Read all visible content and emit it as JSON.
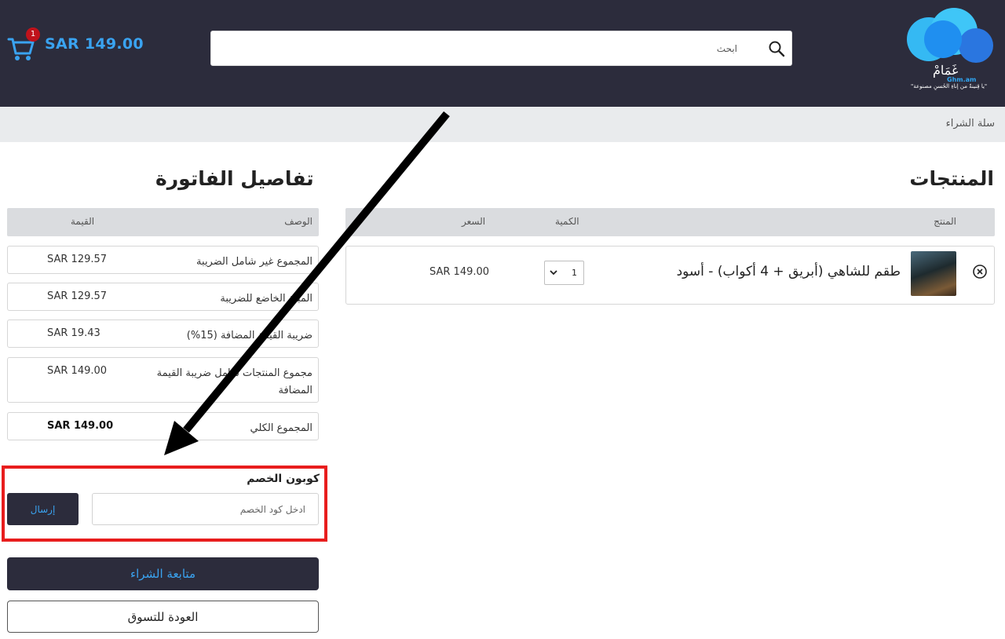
{
  "header": {
    "cart_count": "1",
    "cart_total": "SAR 149.00",
    "search_placeholder": "ابحث",
    "logo_title": "غَمَامْ",
    "logo_en": "Ghm.am",
    "logo_tagline": "\"يا قِنينةً من إناءِ الحُسنِ مصنوعة\""
  },
  "breadcrumb": {
    "label": "سلة الشراء"
  },
  "products": {
    "heading": "المنتجات",
    "columns": {
      "product": "المنتج",
      "quantity": "الكمية",
      "price": "السعر"
    },
    "items": [
      {
        "name": "طقم للشاهي (أبريق + 4 أكواب) - أسود",
        "quantity": "1",
        "price": "SAR 149.00"
      }
    ]
  },
  "invoice": {
    "heading": "تفاصيل الفاتورة",
    "columns": {
      "description": "الوصف",
      "value": "القيمة"
    },
    "rows": [
      {
        "description": "المجموع غير شامل الضريبة",
        "value": "SAR 129.57"
      },
      {
        "description": "المبلغ الخاضع للضريبة",
        "value": "SAR 129.57"
      },
      {
        "description": "ضريبة القيمة المضافة (15%)",
        "value": "SAR 19.43"
      },
      {
        "description": "مجموع المنتجات شامل ضريبة القيمة المضافة",
        "value": "SAR 149.00"
      },
      {
        "description": "المجموع الكلي",
        "value": "SAR 149.00"
      }
    ]
  },
  "coupon": {
    "label": "كوبون الخصم",
    "placeholder": "ادخل كود الخصم",
    "submit_label": "إرسال"
  },
  "actions": {
    "checkout_label": "متابعة الشراء",
    "back_label": "العودة للتسوق"
  },
  "colors": {
    "header_bg": "#2c2c3c",
    "accent": "#3aa3f0",
    "highlight": "#e81d1d",
    "badge": "#c0121b"
  }
}
